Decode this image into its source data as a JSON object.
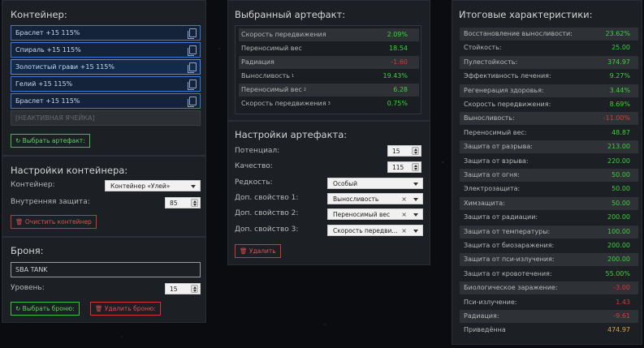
{
  "container": {
    "title": "Контейнер:",
    "slots": [
      {
        "label": "Браслет +15 115%",
        "state": "normal"
      },
      {
        "label": "Спираль +15 115%",
        "state": "normal"
      },
      {
        "label": "Золотистый грави +15 115%",
        "state": "selected"
      },
      {
        "label": "Гелий +15 115%",
        "state": "normal"
      },
      {
        "label": "Браслет +15 115%",
        "state": "normal"
      },
      {
        "label": "[НЕАКТИВНАЯ ЯЧЕЙКА]",
        "state": "inactive"
      }
    ],
    "select_artifact_label": "Выбрать артефакт:",
    "settings_title": "Настройки контейнера:",
    "container_label": "Контейнер:",
    "container_value": "Контейнер «Улей»",
    "internal_protection_label": "Внутренняя защита:",
    "internal_protection_value": "85",
    "clear_label": "Очистить контейнер"
  },
  "armor": {
    "title": "Броня:",
    "name_value": "SBA TANK",
    "level_label": "Уровень:",
    "level_value": "15",
    "select_label": "Выбрать броню:",
    "delete_label": "Удалить броню:"
  },
  "artifact": {
    "title": "Выбранный артефакт:",
    "stats": [
      {
        "name": "Скорость передвижения",
        "value": "2.09%",
        "color": "green",
        "sup": ""
      },
      {
        "name": "Переносимый вес",
        "value": "18.54",
        "color": "green",
        "sup": ""
      },
      {
        "name": "Радиация",
        "value": "-1.60",
        "color": "red",
        "sup": ""
      },
      {
        "name": "Выносливость",
        "value": "19.43%",
        "color": "green",
        "sup": "1"
      },
      {
        "name": "Переносимый вес",
        "value": "6.28",
        "color": "green",
        "sup": "2"
      },
      {
        "name": "Скорость передвижения",
        "value": "0.75%",
        "color": "green",
        "sup": "3"
      }
    ],
    "settings_title": "Настройки артефакта:",
    "potential_label": "Потенциал:",
    "potential_value": "15",
    "quality_label": "Качество:",
    "quality_value": "115",
    "rarity_label": "Редкость:",
    "rarity_value": "Особый",
    "extra1_label": "Доп. свойство 1:",
    "extra1_value": "Выносливость",
    "extra2_label": "Доп. свойство 2:",
    "extra2_value": "Переносимый вес",
    "extra3_label": "Доп. свойство 3:",
    "extra3_value": "Скорость передви...",
    "delete_label": "Удалить"
  },
  "totals": {
    "title": "Итоговые характеристики:",
    "rows": [
      {
        "name": "Восстановление выносливости:",
        "value": "23.62%",
        "color": "green"
      },
      {
        "name": "Стойкость:",
        "value": "25.00",
        "color": "green"
      },
      {
        "name": "Пулестойкость:",
        "value": "374.97",
        "color": "green"
      },
      {
        "name": "Эффективность лечения:",
        "value": "9.27%",
        "color": "green"
      },
      {
        "name": "Регенерация здоровья:",
        "value": "3.44%",
        "color": "green"
      },
      {
        "name": "Скорость передвижения:",
        "value": "8.69%",
        "color": "green"
      },
      {
        "name": "Выносливость:",
        "value": "-11.00%",
        "color": "red"
      },
      {
        "name": "Переносимый вес:",
        "value": "48.87",
        "color": "green"
      },
      {
        "name": "Защита от разрыва:",
        "value": "213.00",
        "color": "green"
      },
      {
        "name": "Защита от взрыва:",
        "value": "220.00",
        "color": "green"
      },
      {
        "name": "Защита от огня:",
        "value": "50.00",
        "color": "green"
      },
      {
        "name": "Электрозащита:",
        "value": "50.00",
        "color": "green"
      },
      {
        "name": "Химзащита:",
        "value": "50.00",
        "color": "green"
      },
      {
        "name": "Защита от радиации:",
        "value": "200.00",
        "color": "green"
      },
      {
        "name": "Защита от температуры:",
        "value": "100.00",
        "color": "green"
      },
      {
        "name": "Защита от биозаражения:",
        "value": "200.00",
        "color": "green"
      },
      {
        "name": "Защита от пси-излучения:",
        "value": "200.00",
        "color": "green"
      },
      {
        "name": "Защита от кровотечения:",
        "value": "55.00%",
        "color": "green"
      },
      {
        "name": "Биологическое заражение:",
        "value": "-3.00",
        "color": "red"
      },
      {
        "name": "Пси-излучение:",
        "value": "1.43",
        "color": "red"
      },
      {
        "name": "Радиация:",
        "value": "-9.61",
        "color": "red"
      },
      {
        "name": "Приведённа",
        "value": "474.97",
        "color": "orange"
      }
    ]
  },
  "colors": {
    "green": "#3fce3f",
    "red": "#d63a3a",
    "orange": "#d9a23a",
    "slot_border": "#3b78d8"
  }
}
